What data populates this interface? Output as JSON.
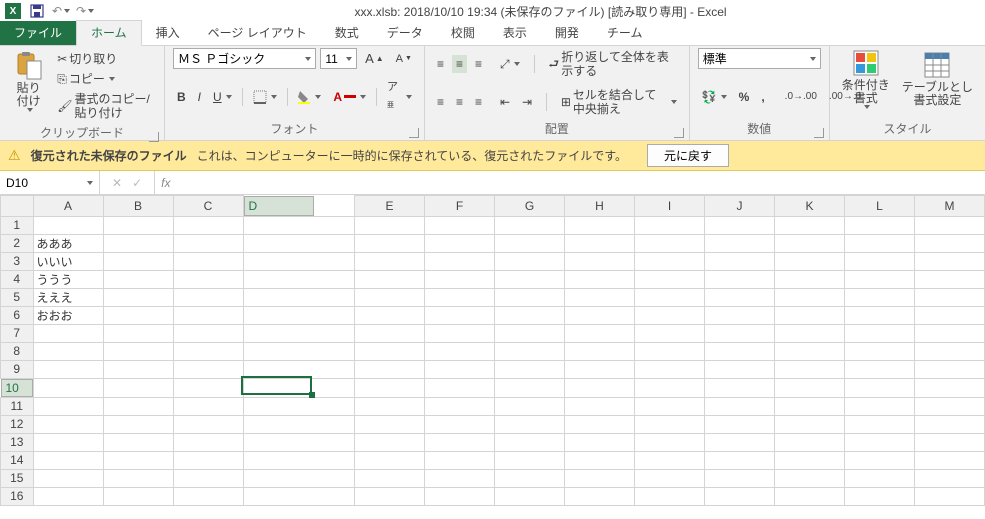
{
  "title": "xxx.xlsb: 2018/10/10 19:34 (未保存のファイル)  [読み取り専用] - Excel",
  "tabs": {
    "file": "ファイル",
    "home": "ホーム",
    "insert": "挿入",
    "layout": "ページ レイアウト",
    "formula": "数式",
    "data": "データ",
    "review": "校閲",
    "view": "表示",
    "dev": "開発",
    "team": "チーム"
  },
  "clip": {
    "cut": "切り取り",
    "copy": "コピー",
    "fmtpaint": "書式のコピー/貼り付け",
    "paste": "貼り付け",
    "title": "クリップボード"
  },
  "font": {
    "name": "ＭＳ Ｐゴシック",
    "size": "11",
    "title": "フォント"
  },
  "align": {
    "wrap": "折り返して全体を表示する",
    "merge": "セルを結合して中央揃え",
    "title": "配置"
  },
  "num": {
    "fmt": "標準",
    "title": "数値"
  },
  "styles": {
    "cond": "条件付き\n書式",
    "table": "テーブルとし\n書式設定",
    "title": "スタイル"
  },
  "bar": {
    "bold": "復元された未保存のファイル",
    "text": "これは、コンピューターに一時的に保存されている、復元されたファイルです。",
    "btn": "元に戻す"
  },
  "namebox": "D10",
  "cols": [
    "A",
    "B",
    "C",
    "D",
    "E",
    "F",
    "G",
    "H",
    "I",
    "J",
    "K",
    "L",
    "M"
  ],
  "rows": [
    "1",
    "2",
    "3",
    "4",
    "5",
    "6",
    "7",
    "8",
    "9",
    "10",
    "11",
    "12",
    "13",
    "14",
    "15",
    "16"
  ],
  "cells": {
    "2": "あああ",
    "3": "いいい",
    "4": "ううう",
    "5": "えええ",
    "6": "おおお"
  },
  "selected": {
    "row": "10",
    "col": "D"
  }
}
